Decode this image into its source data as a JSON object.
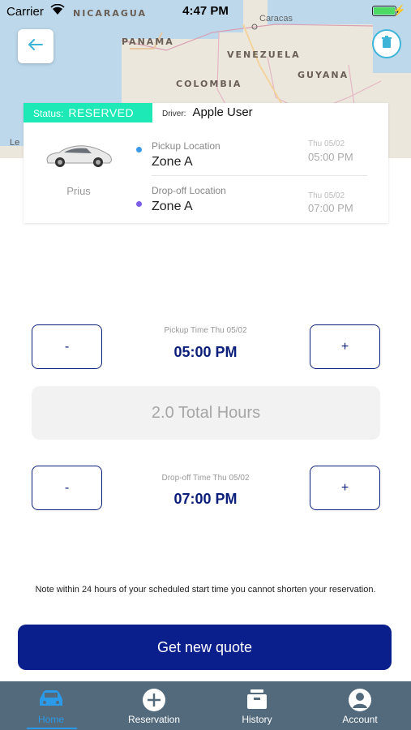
{
  "colors": {
    "accent_navy": "#0b1f8c",
    "status_green": "#1de9b6",
    "active_tab_blue": "#2b9ae8",
    "tabbar_bg": "#536a7d"
  },
  "status_bar": {
    "carrier": "Carrier",
    "time": "4:47 PM",
    "battery_level": 1.0
  },
  "map": {
    "labels": [
      "NICARAGUA",
      "PANAMA",
      "VENEZUELA",
      "COLOMBIA",
      "GUYANA"
    ],
    "city": "Caracas",
    "legal": "Le"
  },
  "icons": {
    "back": "arrow-left-icon",
    "trash": "trash-icon",
    "wifi": "wifi-icon",
    "battery": "battery-icon",
    "car": "car-image"
  },
  "reservation": {
    "status_label": "Status:",
    "status_value": "RESERVED",
    "driver_label": "Driver:",
    "driver_value": "Apple User",
    "car_model": "Prius",
    "pickup": {
      "label": "Pickup Location",
      "value": "Zone A",
      "date": "Thu 05/02",
      "time": "05:00 PM"
    },
    "dropoff": {
      "label": "Drop-off Location",
      "value": "Zone A",
      "date": "Thu 05/02",
      "time": "07:00 PM"
    }
  },
  "adjust": {
    "minus": "-",
    "plus": "+",
    "pickup_caption": "Pickup Time Thu 05/02",
    "pickup_time": "05:00 PM",
    "total_hours": "2.0 Total Hours",
    "dropoff_caption": "Drop-off Time Thu 05/02",
    "dropoff_time": "07:00 PM"
  },
  "note": "Note within 24 hours of your scheduled start time you cannot shorten your reservation.",
  "quote_button": "Get new quote",
  "tabs": [
    {
      "label": "Home",
      "icon": "car-icon",
      "active": true
    },
    {
      "label": "Reservation",
      "icon": "plus-circle-icon",
      "active": false
    },
    {
      "label": "History",
      "icon": "history-box-icon",
      "active": false
    },
    {
      "label": "Account",
      "icon": "user-icon",
      "active": false
    }
  ]
}
